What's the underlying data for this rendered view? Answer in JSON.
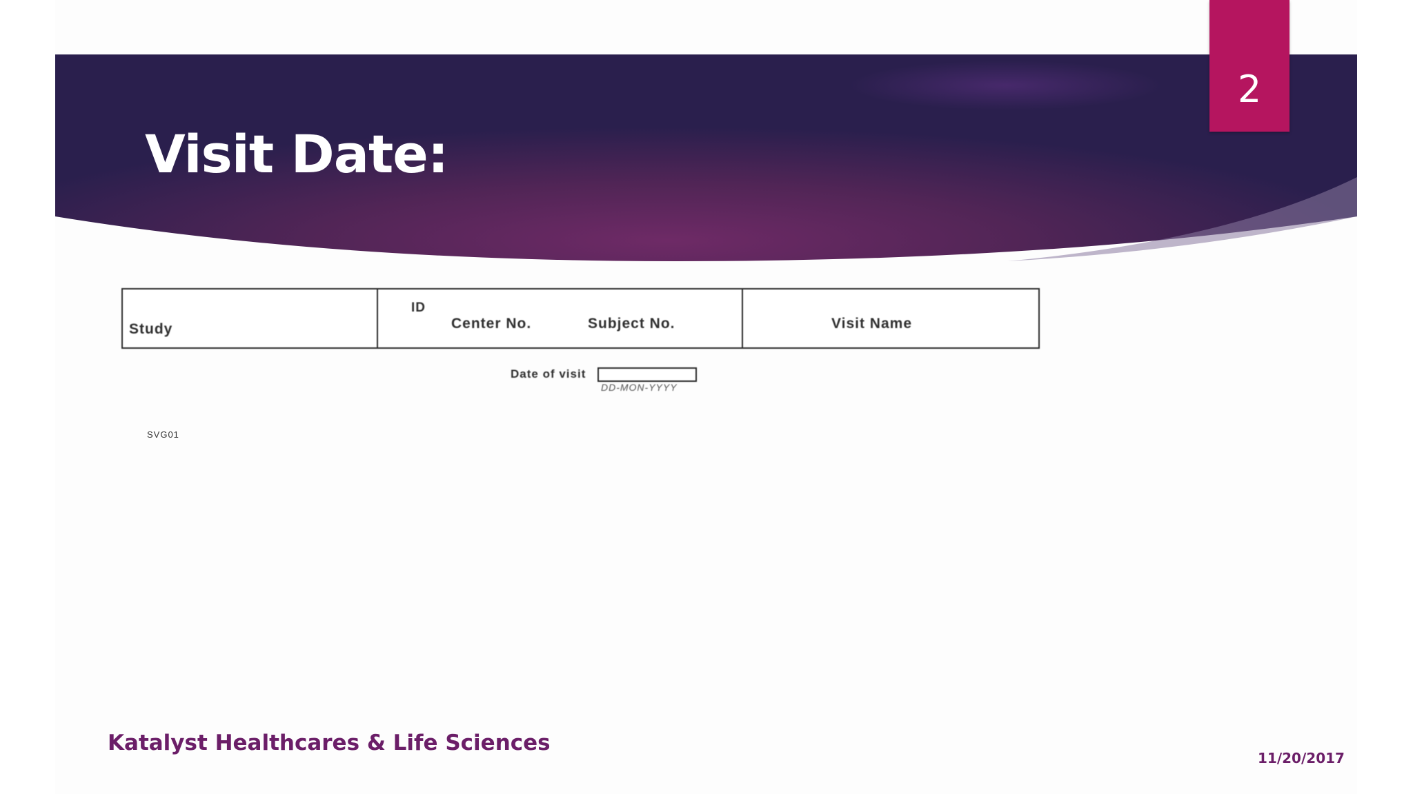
{
  "slide": {
    "title": "Visit Date:",
    "page_number": "2",
    "colors": {
      "header_dark": "#2a1f4d",
      "header_mid": "#6b2a66",
      "badge": "#b5155f",
      "footer_text": "#6b1e68"
    }
  },
  "form": {
    "header": {
      "study": "Study",
      "id": "ID",
      "center_no": "Center No.",
      "subject_no": "Subject No.",
      "visit_name": "Visit Name"
    },
    "date_label": "Date of visit",
    "date_value": "",
    "date_format": "DD-MON-YYYY",
    "form_code": "SVG01"
  },
  "footer": {
    "company": "Katalyst Healthcares & Life Sciences",
    "date": "11/20/2017"
  }
}
